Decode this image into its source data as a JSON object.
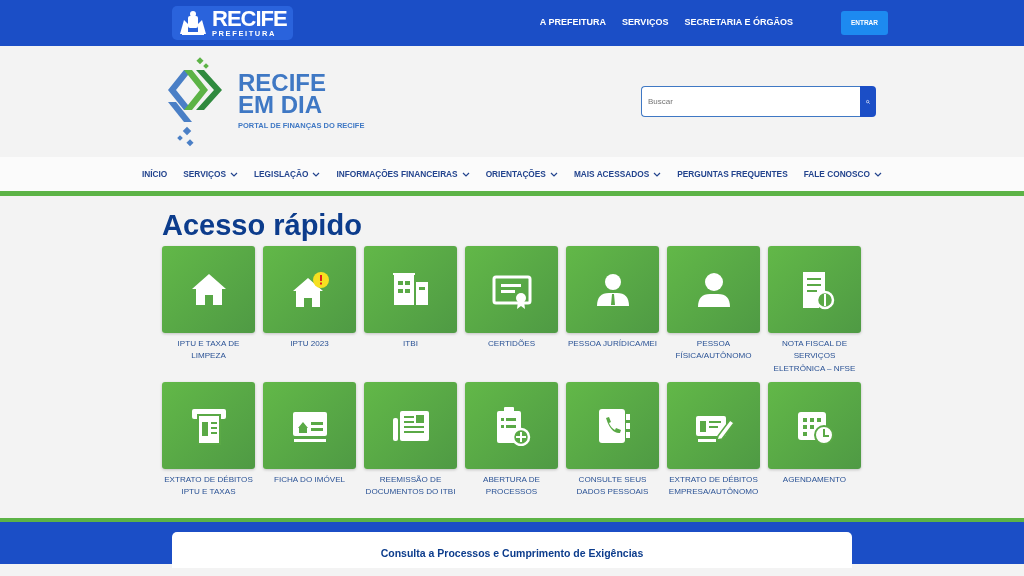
{
  "top_bar": {
    "logo": {
      "title": "RECIFE",
      "subtitle": "PREFEITURA"
    },
    "links": [
      "A PREFEITURA",
      "SERVIÇOS",
      "SECRETARIA E ÓRGÃOS"
    ],
    "button": "ENTRAR"
  },
  "header": {
    "logo": {
      "line_1": "RECIFE",
      "line_2": "EM DIA",
      "tagline": "PORTAL DE FINANÇAS DO RECIFE"
    },
    "search": {
      "placeholder": "Buscar"
    }
  },
  "nav": [
    {
      "label": "INÍCIO",
      "dropdown": false
    },
    {
      "label": "SERVIÇOS",
      "dropdown": true
    },
    {
      "label": "LEGISLAÇÃO",
      "dropdown": true
    },
    {
      "label": "INFORMAÇÕES FINANCEIRAS",
      "dropdown": true
    },
    {
      "label": "ORIENTAÇÕES",
      "dropdown": true
    },
    {
      "label": "MAIS ACESSADOS",
      "dropdown": true
    },
    {
      "label": "PERGUNTAS FREQUENTES",
      "dropdown": false
    },
    {
      "label": "FALE CONOSCO",
      "dropdown": true
    }
  ],
  "quick_access": {
    "title": "Acesso rápido",
    "tiles": [
      {
        "label": "IPTU E TAXA DE LIMPEZA"
      },
      {
        "label": "IPTU 2023"
      },
      {
        "label": "ITBI"
      },
      {
        "label": "CERTIDÕES"
      },
      {
        "label": "PESSOA JURÍDICA/MEI"
      },
      {
        "label": "PESSOA FÍSICA/AUTÔNOMO"
      },
      {
        "label": "NOTA FISCAL DE SERVIÇOS ELETRÔNICA – NFSE"
      },
      {
        "label": "EXTRATO DE DÉBITOS IPTU E TAXAS"
      },
      {
        "label": "FICHA DO IMÓVEL"
      },
      {
        "label": "REEMISSÃO DE DOCUMENTOS DO ITBI"
      },
      {
        "label": "ABERTURA DE PROCESSOS"
      },
      {
        "label": "CONSULTE SEUS DADOS PESSOAIS"
      },
      {
        "label": "EXTRATO DE DÉBITOS EMPRESA/AUTÔNOMO"
      },
      {
        "label": "AGENDAMENTO"
      }
    ]
  },
  "bottom_card": {
    "title": "Consulta a Processos e Cumprimento de Exigências"
  }
}
